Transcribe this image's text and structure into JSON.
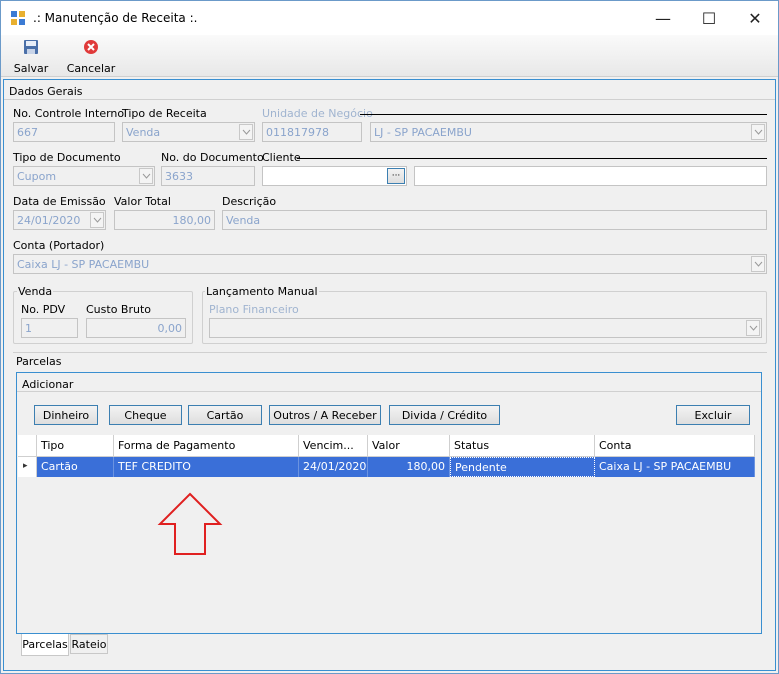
{
  "window": {
    "title": ".: Manutenção de Receita :.",
    "minimize": "—",
    "maximize": "☐",
    "close": "✕"
  },
  "toolbar": {
    "save_label": "Salvar",
    "cancel_label": "Cancelar"
  },
  "section": "Dados Gerais",
  "fields": {
    "controle_label": "No. Controle Interno",
    "controle_value": "667",
    "tipo_receita_label": "Tipo de Receita",
    "tipo_receita_value": "Venda",
    "unidade_label": "Unidade de Negócio",
    "unidade_code": "011817978",
    "unidade_value": "LJ - SP PACAEMBU",
    "tipo_doc_label": "Tipo de Documento",
    "tipo_doc_value": "Cupom",
    "no_doc_label": "No. do Documento",
    "no_doc_value": "3633",
    "cliente_label": "Cliente",
    "cliente_code": "",
    "cliente_name": "",
    "cliente_lookup": "···",
    "data_label": "Data de Emissão",
    "data_value": "24/01/2020",
    "valor_label": "Valor Total",
    "valor_value": "180,00",
    "descricao_label": "Descrição",
    "descricao_value": "Venda",
    "conta_label": "Conta (Portador)",
    "conta_value": "Caixa LJ - SP PACAEMBU"
  },
  "venda": {
    "title": "Venda",
    "pdv_label": "No. PDV",
    "pdv_value": "1",
    "custo_label": "Custo Bruto",
    "custo_value": "0,00"
  },
  "lancamento": {
    "title": "Lançamento Manual",
    "plano_label": "Plano Financeiro",
    "plano_value": ""
  },
  "parcelas": {
    "title": "Parcelas",
    "adicionar_title": "Adicionar",
    "buttons": {
      "dinheiro": "Dinheiro",
      "cheque": "Cheque",
      "cartao": "Cartão",
      "outros": "Outros / A Receber",
      "divida": "Divida / Crédito",
      "excluir": "Excluir"
    },
    "columns": [
      "Tipo",
      "Forma de Pagamento",
      "Vencim...",
      "Valor",
      "Status",
      "Conta"
    ],
    "rows": [
      [
        "Cartão",
        "TEF CREDITO",
        "24/01/2020",
        "180,00",
        "Pendente",
        "Caixa LJ - SP PACAEMBU"
      ]
    ],
    "row_marker": "▸"
  },
  "tabs": {
    "parcelas": "Parcelas",
    "rateio": "Rateio"
  },
  "colors": {
    "accent": "#3a8fd0",
    "selection": "#3a6fd8",
    "annotation_arrow": "#e02020"
  },
  "annotation": {
    "shape": "arrow-up-outline"
  }
}
